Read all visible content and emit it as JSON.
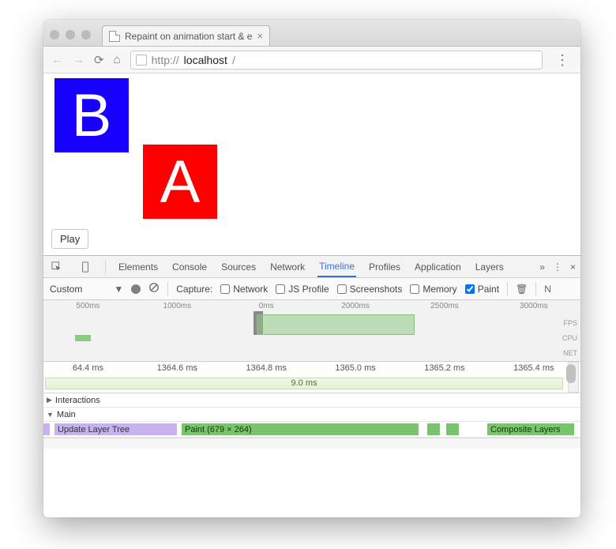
{
  "tab": {
    "title": "Repaint on animation start & e",
    "close_glyph": "×"
  },
  "toolbar": {
    "url_host": "localhost",
    "url_path": "/",
    "url_prefix_scheme": "http://"
  },
  "viewport": {
    "block_b": "B",
    "block_a": "A",
    "play_label": "Play"
  },
  "devtools": {
    "tabs": [
      "Elements",
      "Console",
      "Sources",
      "Network",
      "Timeline",
      "Profiles",
      "Application",
      "Layers"
    ],
    "active_tab": "Timeline",
    "more_glyph": "»",
    "kebab_glyph": "⋮",
    "close_glyph": "×"
  },
  "capture_bar": {
    "mode_label": "Custom",
    "mode_caret": "▼",
    "capture_label": "Capture:",
    "checks": [
      {
        "label": "Network",
        "checked": false
      },
      {
        "label": "JS Profile",
        "checked": false
      },
      {
        "label": "Screenshots",
        "checked": false
      },
      {
        "label": "Memory",
        "checked": false
      },
      {
        "label": "Paint",
        "checked": true
      }
    ],
    "trash_glyph": "🗑",
    "overflow_hint": "N"
  },
  "overview": {
    "ticks": [
      "500ms",
      "1000ms",
      "0ms",
      "2000ms",
      "2500ms",
      "3000ms"
    ],
    "lanes": [
      "FPS",
      "CPU",
      "NET"
    ]
  },
  "detail_ruler": {
    "ticks": [
      "64.4 ms",
      "1364.6 ms",
      "1364.8 ms",
      "1365.0 ms",
      "1365.2 ms",
      "1365.4 ms"
    ],
    "range_label": "9.0 ms"
  },
  "tracks": {
    "interactions_label": "Interactions",
    "main_label": "Main",
    "segments": {
      "update_layer_tree": "Update Layer Tree",
      "paint": "Paint (679 × 264)",
      "composite": "Composite Layers"
    }
  }
}
